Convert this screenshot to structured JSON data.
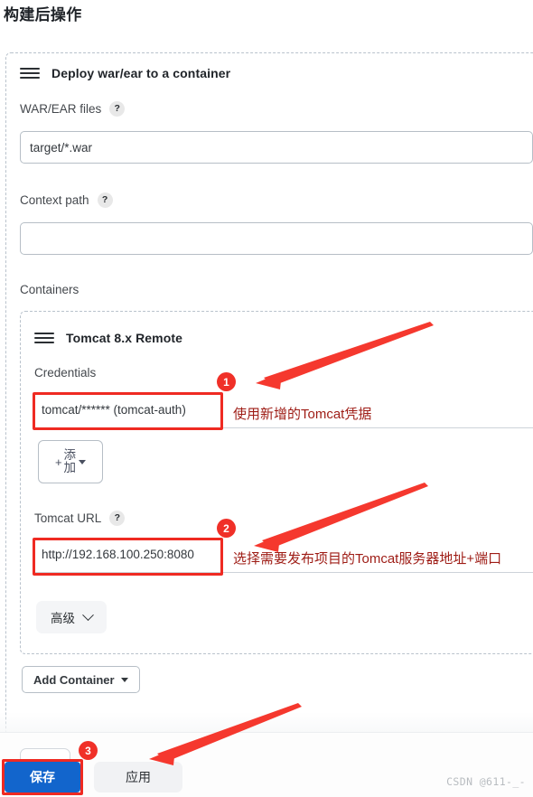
{
  "page": {
    "title": "构建后操作",
    "watermark": "CSDN @611-_-"
  },
  "section": {
    "title": "Deploy war/ear to a container",
    "hamburger_icon": "drag-handle-icon"
  },
  "fields": {
    "war_ear": {
      "label": "WAR/EAR files",
      "help": "?",
      "value": "target/*.war"
    },
    "context_path": {
      "label": "Context path",
      "help": "?",
      "value": ""
    },
    "containers_label": "Containers"
  },
  "container": {
    "title": "Tomcat 8.x Remote",
    "hamburger_icon": "drag-handle-icon",
    "credentials": {
      "label": "Credentials",
      "value": "tomcat/****** (tomcat-auth)"
    },
    "add_button": {
      "plus": "+",
      "label_line1": "添",
      "label_line2": "加",
      "caret_icon": "caret-down-icon"
    },
    "tomcat_url": {
      "label": "Tomcat URL",
      "help": "?",
      "value": "http://192.168.100.250:8080"
    },
    "advanced": {
      "label": "高级",
      "caret_icon": "chevron-down-icon"
    }
  },
  "buttons": {
    "add_container": {
      "label": "Add Container",
      "caret_icon": "caret-down-icon"
    },
    "save": "保存",
    "apply": "应用"
  },
  "annotations": [
    {
      "badge": "1",
      "text": "使用新增的Tomcat凭据"
    },
    {
      "badge": "2",
      "text": "选择需要发布项目的Tomcat服务器地址+端口"
    },
    {
      "badge": "3",
      "text": ""
    }
  ],
  "colors": {
    "annotation_red": "#ef2a22",
    "annotation_text": "#9e1c15",
    "badge_red": "#f03028",
    "save_blue": "#1265cc"
  }
}
